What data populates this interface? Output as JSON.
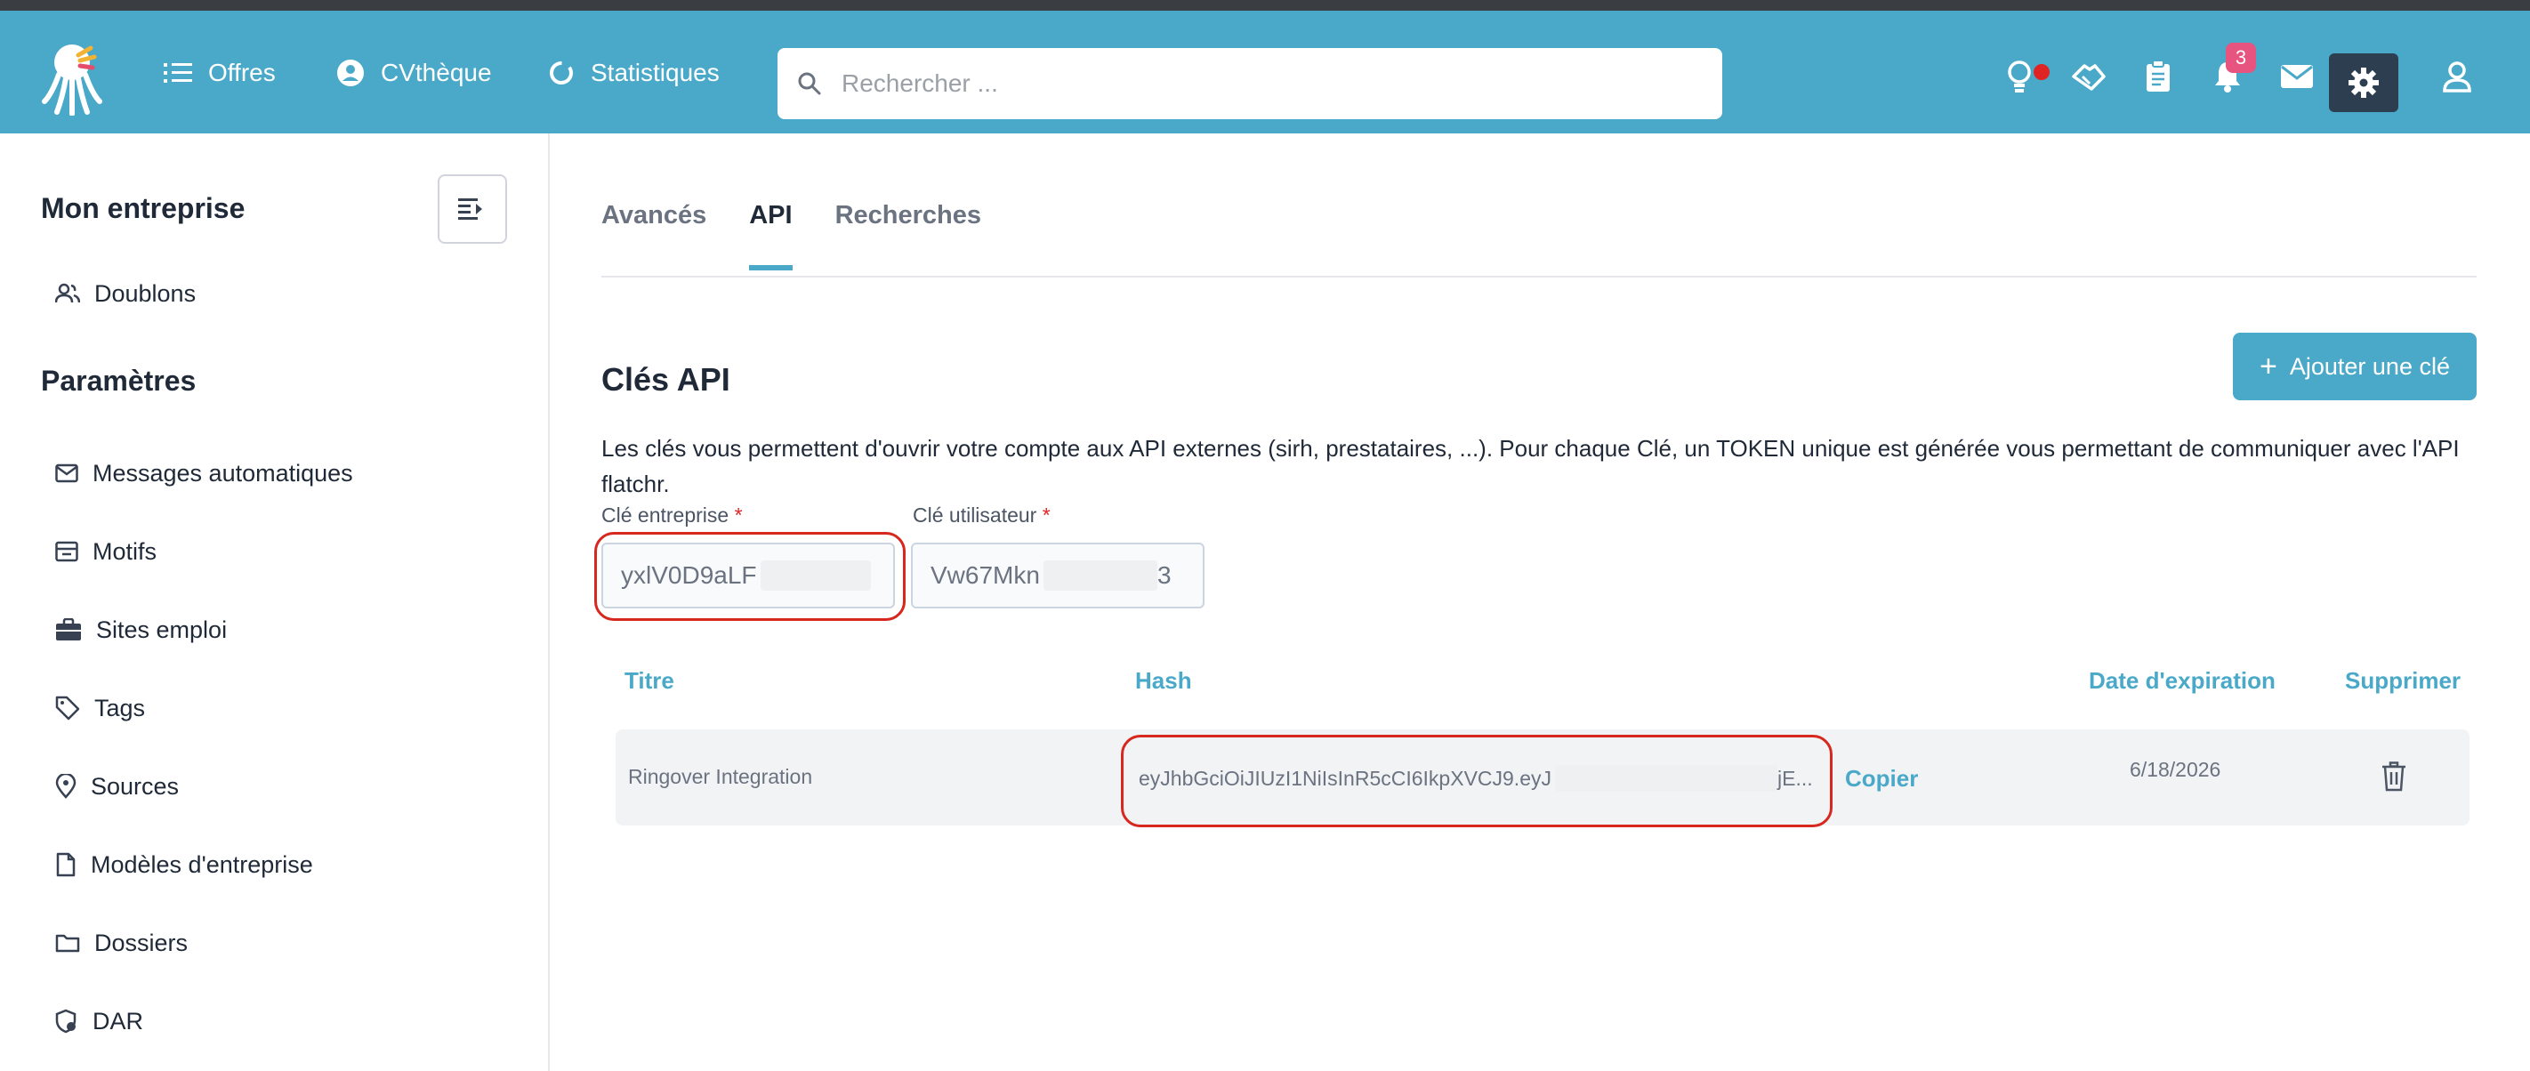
{
  "nav": {
    "items": [
      {
        "label": "Offres",
        "icon": "list-icon"
      },
      {
        "label": "CVthèque",
        "icon": "user-circle-icon"
      },
      {
        "label": "Statistiques",
        "icon": "refresh-icon"
      }
    ],
    "search_placeholder": "Rechercher ...",
    "notification_count": "3"
  },
  "sidebar": {
    "section1_title": "Mon entreprise",
    "section1_items": [
      {
        "label": "Doublons",
        "icon": "users-icon"
      }
    ],
    "section2_title": "Paramètres",
    "section2_items": [
      {
        "label": "Messages automatiques",
        "icon": "mail-icon"
      },
      {
        "label": "Motifs",
        "icon": "archive-icon"
      },
      {
        "label": "Sites emploi",
        "icon": "briefcase-icon"
      },
      {
        "label": "Tags",
        "icon": "tag-icon"
      },
      {
        "label": "Sources",
        "icon": "location-icon"
      },
      {
        "label": "Modèles d'entreprise",
        "icon": "file-icon"
      },
      {
        "label": "Dossiers",
        "icon": "folder-icon"
      },
      {
        "label": "DAR",
        "icon": "shield-icon"
      }
    ]
  },
  "tabs": [
    {
      "label": "Avancés",
      "active": false
    },
    {
      "label": "API",
      "active": true
    },
    {
      "label": "Recherches",
      "active": false
    }
  ],
  "api": {
    "title": "Clés API",
    "add_button": "Ajouter une clé",
    "description": "Les clés vous permettent d'ouvrir votre compte aux API externes (sirh, prestataires, ...). Pour chaque Clé, un TOKEN unique est générée vous permettant de communiquer avec l'API flatchr.",
    "company_key_label": "Clé entreprise",
    "company_key_value": "yxlV0D9aLF",
    "user_key_label": "Clé utilisateur",
    "user_key_value": "Vw67Mkn",
    "user_key_suffix": "3",
    "required_mark": "*"
  },
  "table": {
    "headers": {
      "title": "Titre",
      "hash": "Hash",
      "expiration": "Date d'expiration",
      "delete": "Supprimer"
    },
    "rows": [
      {
        "title": "Ringover Integration",
        "hash": "eyJhbGciOiJIUzI1NiIsInR5cCI6IkpXVCJ9.eyJ",
        "hash_tail": "jE...",
        "copy_label": "Copier",
        "expiration": "6/18/2026"
      }
    ]
  },
  "colors": {
    "topbar": "#4aa9c8",
    "accent": "#4aa9c8",
    "highlight": "#d6281e",
    "badge": "#e75480"
  }
}
